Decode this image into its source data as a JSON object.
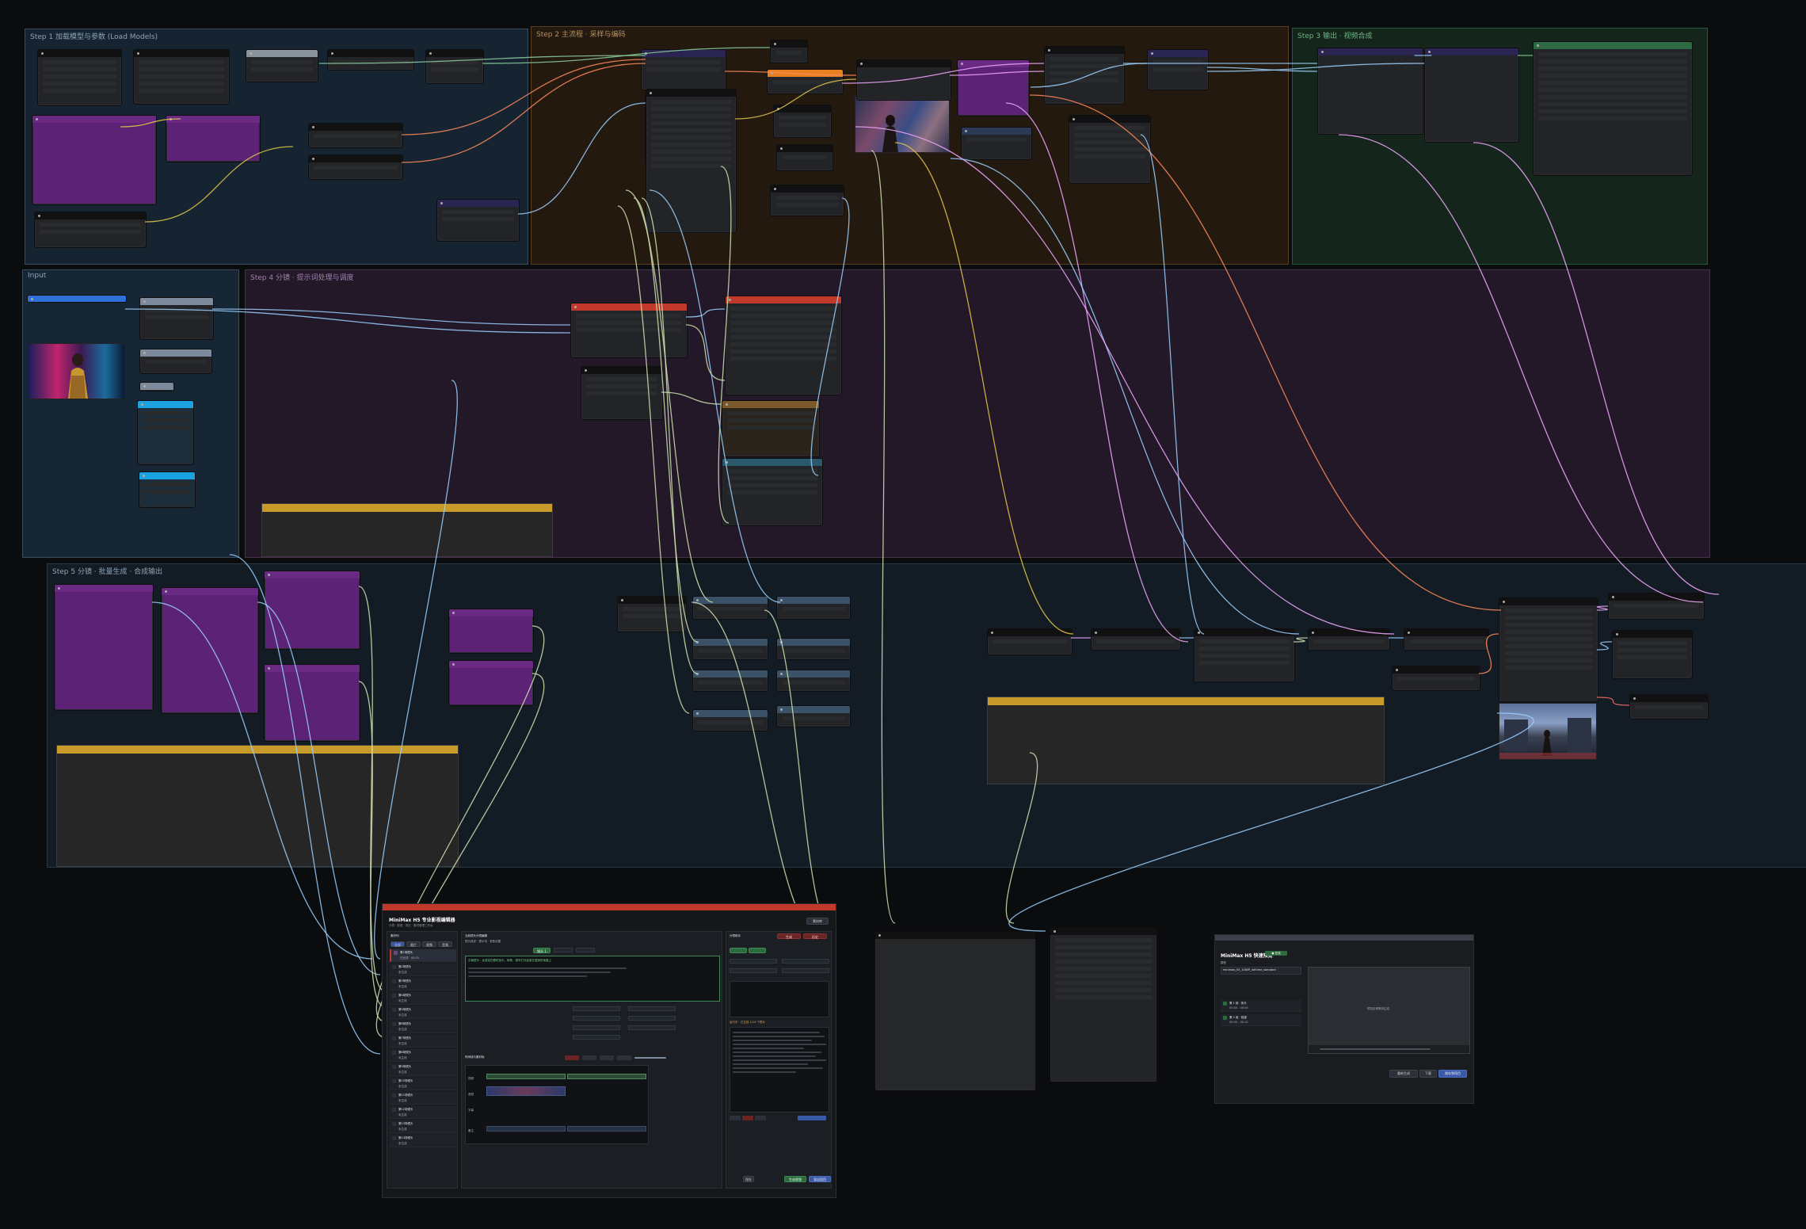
{
  "panel_one": {
    "title": "MiniMax H5 专业影视编辑器",
    "subtitle": "分镜 · 配音 · 导出 · 素材管理工作台",
    "top_buttons": [
      "素材库",
      "设置",
      "导出全部",
      "清空"
    ],
    "left_header": "素材列",
    "left_tabs": [
      "全部",
      "图片",
      "视频",
      "音频"
    ],
    "episodes": [
      {
        "name": "第1场镜头",
        "meta": "已完成 · 00:05"
      },
      {
        "name": "第2场镜头",
        "meta": "未生成"
      },
      {
        "name": "第3场镜头",
        "meta": "未生成"
      },
      {
        "name": "第4场镜头",
        "meta": "未生成"
      },
      {
        "name": "第5场镜头",
        "meta": "未生成"
      },
      {
        "name": "第6场镜头",
        "meta": "未生成"
      },
      {
        "name": "第7场镜头",
        "meta": "未生成"
      },
      {
        "name": "第8场镜头",
        "meta": "未生成"
      },
      {
        "name": "第9场镜头",
        "meta": "未生成"
      },
      {
        "name": "第10场镜头",
        "meta": "未生成"
      },
      {
        "name": "第11场镜头",
        "meta": "未生成"
      },
      {
        "name": "第12场镜头",
        "meta": "未生成"
      },
      {
        "name": "第13场镜头",
        "meta": "未生成"
      },
      {
        "name": "第14场镜头",
        "meta": "未生成"
      }
    ],
    "center_header": "当前镜头分镜编辑",
    "center_sub": "镜头描述 · 提示词 · 参数设置",
    "scene_label": "镜头 1",
    "scene_note": "中景镜头：女孩站在霓虹街头，雨夜，城市灯光反射在湿润的地面上",
    "timeline_header": "时间线与素材轨",
    "tracks": [
      "视频",
      "音频",
      "字幕",
      "备注"
    ],
    "right_header": "分镜助手",
    "right_tabs": [
      "生成",
      "历史"
    ],
    "status_text": "运行中 · 已生成 1/14 个镜头",
    "bottom_buttons": [
      "保存",
      "生成视频",
      "导出项目"
    ]
  },
  "panel_two": {
    "title": "MiniMax H5 快速预览",
    "tag": "● 在线",
    "model_label": "模型",
    "model_value": "minimax_h5_1080P_rolltime_standard",
    "preview_placeholder": "预览区域等待生成",
    "items": [
      {
        "title": "第 1 段 · 街头",
        "meta": "00:00 - 00:05"
      },
      {
        "title": "第 2 段 · 回望",
        "meta": "00:05 - 00:10"
      }
    ],
    "buttons": [
      "重新生成",
      "下载",
      "保存到项目"
    ]
  },
  "groups": [
    {
      "id": "g1",
      "title": "Step 1 加载模型与参数 (Load Models)"
    },
    {
      "id": "g2",
      "title": "Step 2 主流程 · 采样与编码"
    },
    {
      "id": "g3",
      "title": "Step 3 输出 · 视频合成"
    },
    {
      "id": "g4",
      "title": "Input"
    },
    {
      "id": "g5",
      "title": "Step 4 分镜 · 提示词处理与调度"
    },
    {
      "id": "g6",
      "title": "Step 5 分镜 · 批量生成 · 合成输出"
    }
  ]
}
